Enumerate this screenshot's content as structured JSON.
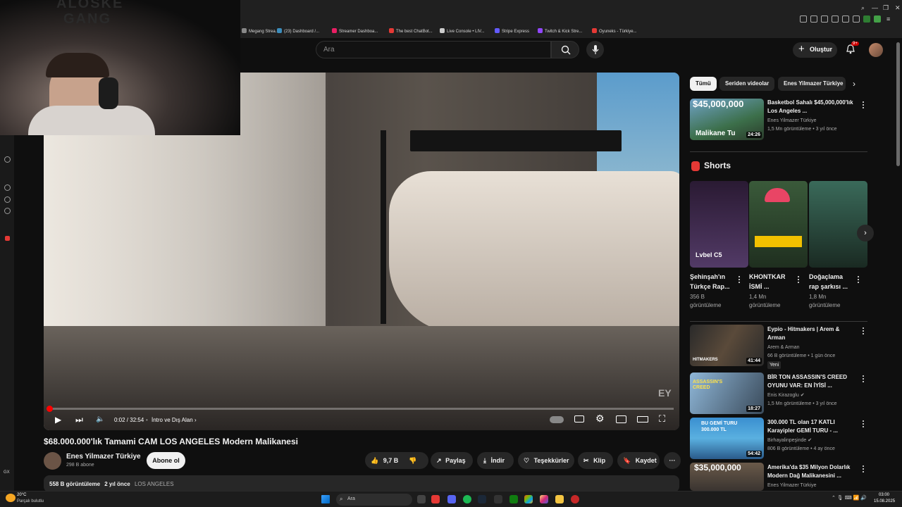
{
  "bookmarks": [
    {
      "label": "Megang Strea...",
      "color": "#888888"
    },
    {
      "label": "(23) Dashboard /...",
      "color": "#3c8dbc"
    },
    {
      "label": "Streamer Dashboa...",
      "color": "#e91e63"
    },
    {
      "label": "The best ChatBot...",
      "color": "#e53935"
    },
    {
      "label": "Live Console • LIV...",
      "color": "#cccccc"
    },
    {
      "label": "Stripe Express",
      "color": "#635bff"
    },
    {
      "label": "Twitch & Kick Stre...",
      "color": "#9146ff"
    },
    {
      "label": "Oyuneks - Türkiye...",
      "color": "#e53935"
    }
  ],
  "webcam": {
    "overlay_text_line1": "ALOSKE",
    "overlay_text_line2": "GANG"
  },
  "header": {
    "search_placeholder": "Ara",
    "create_label": "Oluştur",
    "notification_badge": "9+"
  },
  "player": {
    "time": "0:02 / 32:54",
    "chapter": "İntro ve Dış Alan",
    "chapter_arrow": "›",
    "watermark": "EY",
    "progress_fraction": 0.005
  },
  "video": {
    "title": "$68.000.000'lık Tamami CAM LOS ANGELES Modern Malikanesi",
    "channel": "Enes Yilmazer Türkiye",
    "subscribers": "298 B abone",
    "subscribe_label": "Abone ol",
    "likes": "9,7 B",
    "share_label": "Paylaş",
    "download_label": "İndir",
    "thanks_label": "Teşekkürler",
    "clip_label": "Klip",
    "save_label": "Kaydet",
    "views": "558 B görüntüleme",
    "age": "2 yıl önce",
    "location": "LOS ANGELES"
  },
  "chips": [
    "Tümü",
    "Seriden videolar",
    "Enes Yilmazer Türkiye"
  ],
  "recommended_top": {
    "title": "Basketbol Sahalı $45,000,000'lık Los Angeles ...",
    "channel": "Enes Yilmazer Türkiye",
    "meta": "1,5 Mn görüntüleme • 3 yıl önce",
    "duration": "24:26",
    "thumb_text1": "$45,000,000",
    "thumb_text2": "Malikane Tu"
  },
  "shorts": {
    "heading": "Shorts",
    "items": [
      {
        "title": "Şehinşah'ın Türkçe Rap...",
        "views": "356 B görüntüleme",
        "thumb_text": "Lvbel C5"
      },
      {
        "title": "KHONTKAR İSMİ ...",
        "views": "1,4 Mn görüntüleme",
        "thumb_text": ""
      },
      {
        "title": "Doğaçlama rap şarkısı ...",
        "views": "1,8 Mn görüntüleme",
        "thumb_text": ""
      }
    ]
  },
  "recommended": [
    {
      "title": "Eypio - Hitmakers | Arem & Arman",
      "channel": "Arem & Arman",
      "meta": "66 B görüntüleme • 1 gün önce",
      "badge": "Yeni",
      "duration": "41:44",
      "thumb_text": "HITMAKERS",
      "verified": false
    },
    {
      "title": "BİR TON ASSASSIN'S CREED OYUNU VAR: EN İYİSİ ...",
      "channel": "Enis Kirazoglu",
      "meta": "1,5 Mn görüntüleme • 3 yıl önce",
      "badge": "",
      "duration": "18:27",
      "thumb_text": "ASSASSIN'S CREED",
      "verified": true
    },
    {
      "title": "300.000 TL olan 17 KATLI Karayipler GEMİ TURU - ...",
      "channel": "Birhayalinpeşinde",
      "meta": "806 B görüntüleme • 4 ay önce",
      "badge": "",
      "duration": "54:42",
      "thumb_text": "BU GEMİ TURU 300.000 TL",
      "verified": true
    },
    {
      "title": "Amerika'da $35 Milyon Dolarlık Modern Dağ Malikanesini ...",
      "channel": "Enes Yilmazer Türkiye",
      "meta": "",
      "badge": "",
      "duration": "",
      "thumb_text": "$35,000,000",
      "verified": false
    }
  ],
  "taskbar": {
    "weather_temp": "20°C",
    "weather_desc": "Parçalı bulutlu",
    "search_label": "Ara",
    "time": "03:00",
    "date": "15.08.2025"
  },
  "colors": {
    "accent_red": "#ff0000",
    "bg": "#0f0f0f",
    "pill": "#272727"
  }
}
